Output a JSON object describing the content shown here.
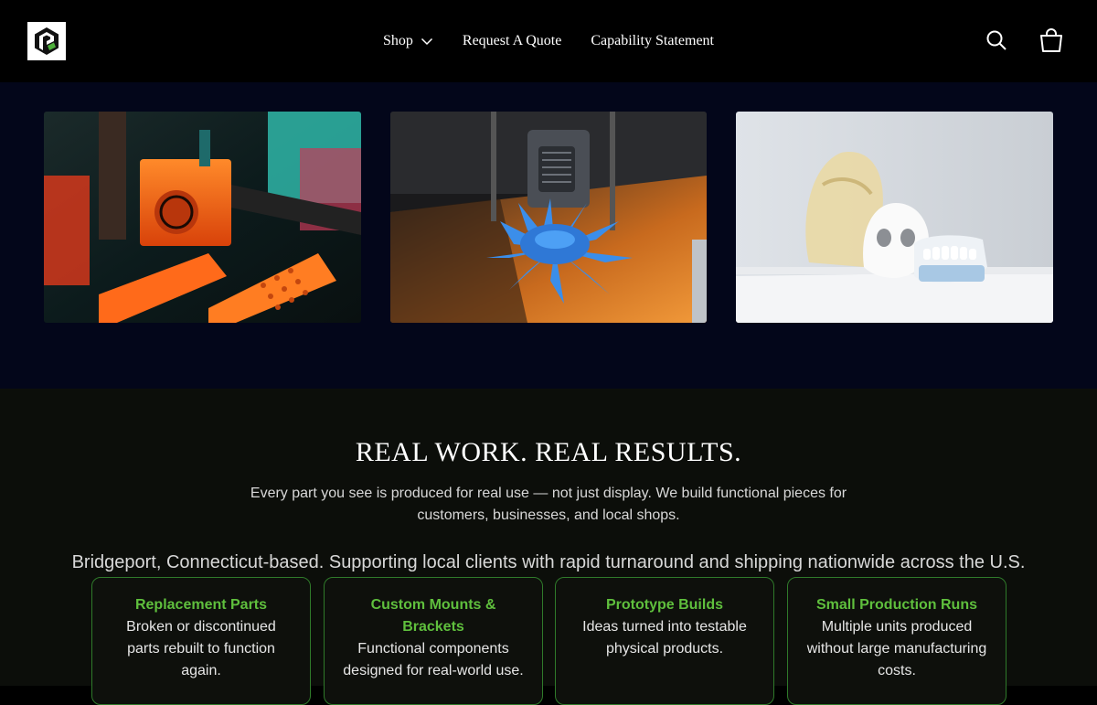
{
  "brand": {
    "logo_icon": "brand-logo-icon"
  },
  "nav": {
    "shop": "Shop",
    "quote": "Request A Quote",
    "capability": "Capability Statement"
  },
  "icons": {
    "search": "search-icon",
    "cart": "bag-icon",
    "chevron": "chevron-down-icon"
  },
  "gallery": [
    {
      "name": "orange-printer-photo"
    },
    {
      "name": "blue-print-photo"
    },
    {
      "name": "skull-models-photo"
    }
  ],
  "results": {
    "title": "REAL WORK. REAL RESULTS.",
    "subtitle": "Every part you see is produced for real use — not just display. We build functional pieces for customers, businesses, and local shops.",
    "location": "Bridgeport, Connecticut-based. Supporting local clients with rapid turnaround and shipping nationwide across the U.S.",
    "cards": [
      {
        "title": "Replacement Parts",
        "desc": "Broken or discontinued parts rebuilt to function again."
      },
      {
        "title": "Custom Mounts & Brackets",
        "desc": "Functional components designed for real-world use."
      },
      {
        "title": "Prototype Builds",
        "desc": "Ideas turned into testable physical products."
      },
      {
        "title": "Small Production Runs",
        "desc": "Multiple units produced without large manufacturing costs."
      }
    ]
  },
  "colors": {
    "header_bg": "#000000",
    "gallery_bg": "#03061a",
    "results_bg": "#0c0e0a",
    "accent_green": "#5fbf3d",
    "card_border": "#2f7a2a"
  }
}
